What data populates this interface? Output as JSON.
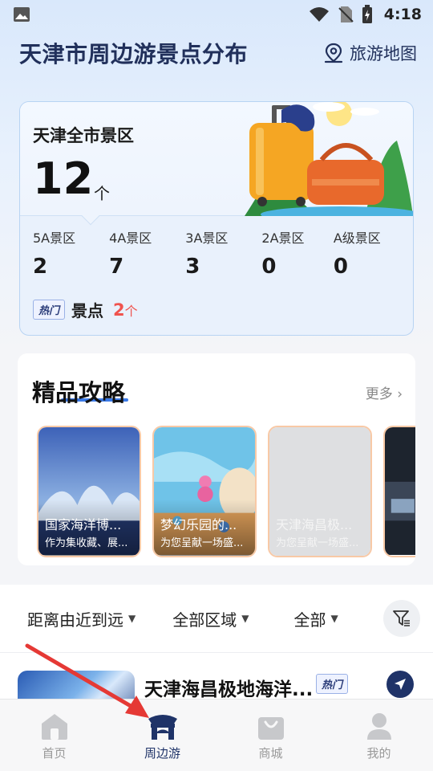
{
  "status_bar": {
    "time": "4:18"
  },
  "header": {
    "title": "天津市周边游景点分布",
    "map_label": "旅游地图"
  },
  "stats": {
    "city_label": "天津全市景区",
    "total": "12",
    "total_unit": "个",
    "grades": [
      {
        "label": "5A景区",
        "value": "2"
      },
      {
        "label": "4A景区",
        "value": "7"
      },
      {
        "label": "3A景区",
        "value": "3"
      },
      {
        "label": "2A景区",
        "value": "0"
      },
      {
        "label": "A级景区",
        "value": "0"
      }
    ],
    "hot_badge": "热门",
    "hot_label": "景点",
    "hot_count": "2",
    "hot_unit": "个"
  },
  "guides": {
    "title": "精品攻略",
    "more_label": "更多",
    "items": [
      {
        "title": "国家海洋博...",
        "desc": "作为集收藏、展..."
      },
      {
        "title": "梦幻乐园的...",
        "desc": "为您呈献一场盛..."
      },
      {
        "title": "天津海昌极...",
        "desc": "为您呈献一场盛..."
      }
    ]
  },
  "filters": {
    "sort": "距离由近到远",
    "area": "全部区域",
    "type": "全部"
  },
  "list": {
    "items": [
      {
        "title": "天津海昌极地海洋...",
        "badge": "热门"
      }
    ]
  },
  "bottom_nav": {
    "items": [
      {
        "label": "首页",
        "icon": "home-icon"
      },
      {
        "label": "周边游",
        "icon": "pavilion-icon"
      },
      {
        "label": "商城",
        "icon": "shopping-bag-icon"
      },
      {
        "label": "我的",
        "icon": "user-icon"
      }
    ],
    "active_index": 1
  },
  "colors": {
    "accent": "#1f3368",
    "hot": "#f0534e",
    "link_blue": "#3a7ae8",
    "annotation_arrow": "#e53935"
  }
}
